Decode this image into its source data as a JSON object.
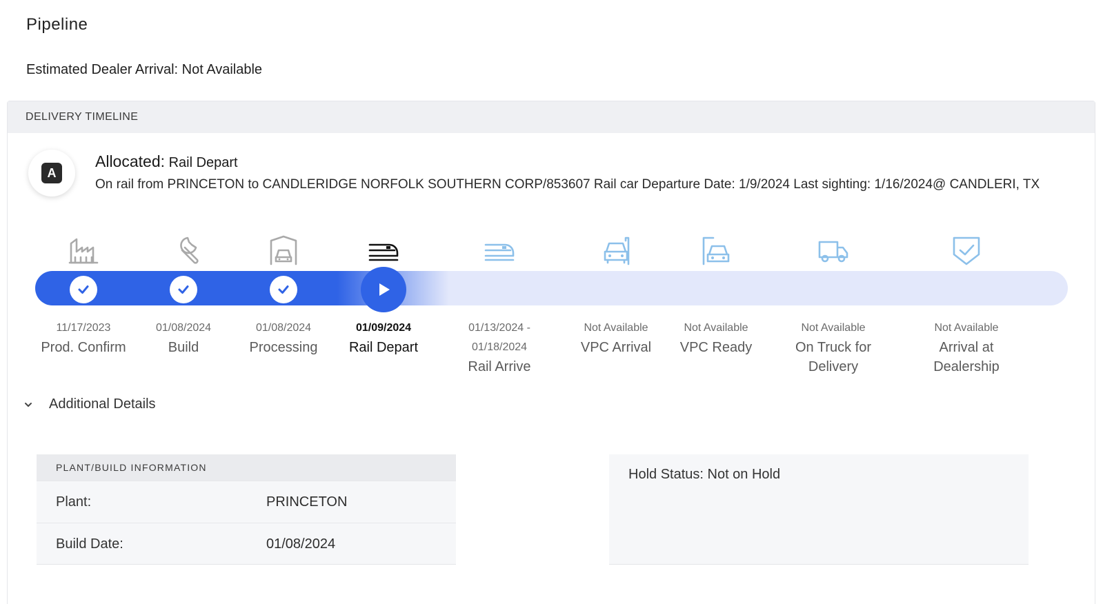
{
  "page": {
    "title": "Pipeline",
    "eta": "Estimated Dealer Arrival: Not Available"
  },
  "timeline_card": {
    "header": "DELIVERY TIMELINE",
    "avatar_letter": "A",
    "status_label": "Allocated:",
    "status_value": "Rail Depart",
    "status_desc": "On rail from PRINCETON to CANDLERIDGE NORFOLK SOUTHERN CORP/853607 Rail car Departure Date: 1/9/2024 Last sighting: 1/16/2024@ CANDLERI, TX"
  },
  "steps": [
    {
      "date": "11/17/2023",
      "label": "Prod. Confirm",
      "icon": "factory-icon",
      "state": "done"
    },
    {
      "date": "01/08/2024",
      "label": "Build",
      "icon": "wrench-icon",
      "state": "done"
    },
    {
      "date": "01/08/2024",
      "label": "Processing",
      "icon": "garage-car-icon",
      "state": "done"
    },
    {
      "date": "01/09/2024",
      "label": "Rail Depart",
      "icon": "train-icon",
      "state": "current"
    },
    {
      "date": "01/13/2024 - 01/18/2024",
      "label": "Rail Arrive",
      "icon": "train-arrive-icon",
      "state": "pending"
    },
    {
      "date": "Not Available",
      "label": "VPC Arrival",
      "icon": "car-arrival-icon",
      "state": "pending"
    },
    {
      "date": "Not Available",
      "label": "VPC Ready",
      "icon": "car-ready-icon",
      "state": "pending"
    },
    {
      "date": "Not Available",
      "label": "On Truck for Delivery",
      "icon": "truck-icon",
      "state": "pending"
    },
    {
      "date": "Not Available",
      "label": "Arrival at Dealership",
      "icon": "shield-check-icon",
      "state": "pending"
    }
  ],
  "progress": {
    "current_step_index": 3,
    "total_steps": 9
  },
  "details": {
    "toggle_label": "Additional Details",
    "plant_panel": {
      "header": "PLANT/BUILD INFORMATION",
      "rows": [
        {
          "key": "Plant:",
          "value": "PRINCETON"
        },
        {
          "key": "Build Date:",
          "value": "01/08/2024"
        }
      ]
    },
    "hold_status": "Hold Status: Not on Hold"
  },
  "colors": {
    "accent": "#2f63e6",
    "track": "#e3e8fb",
    "done_icon": "#a9a9a9",
    "pending_icon": "#8cc0ea"
  }
}
